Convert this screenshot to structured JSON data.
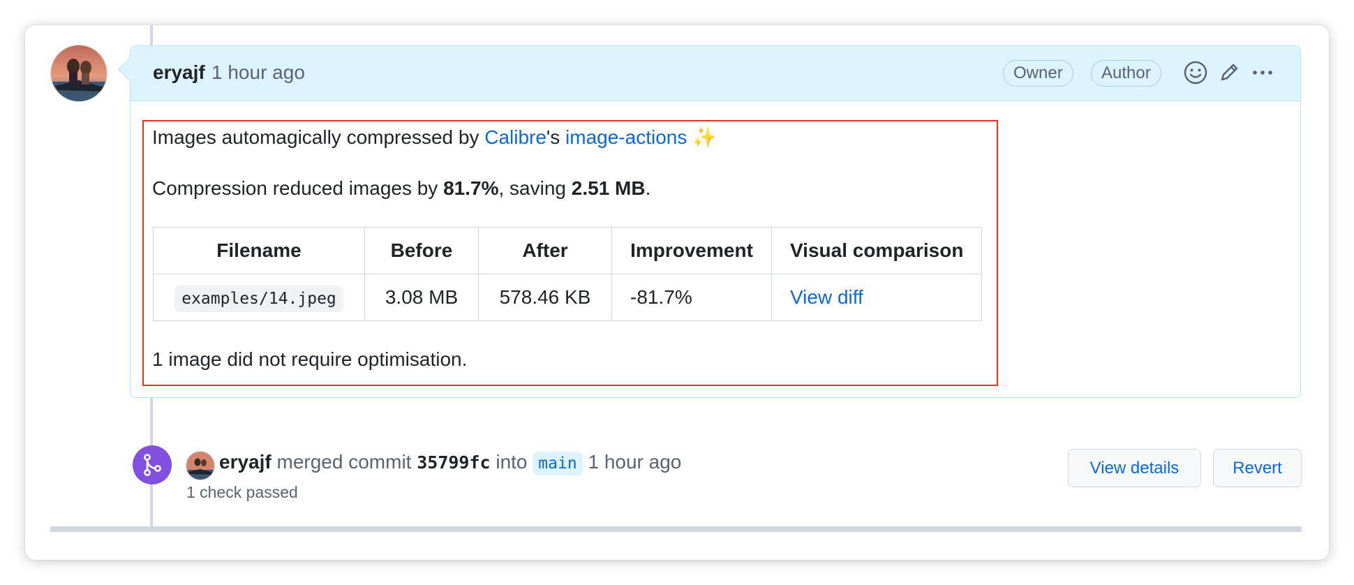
{
  "comment": {
    "author": "eryajf",
    "time": "1 hour ago",
    "badges": {
      "owner": "Owner",
      "author": "Author"
    },
    "icons": {
      "emoji": "smiley-icon",
      "edit": "pencil-icon",
      "more": "kebab-horizontal-icon"
    },
    "body": {
      "intro_prefix": "Images automagically compressed by ",
      "calibre_link": "Calibre",
      "apostrophe": "'s ",
      "image_actions_link": "image-actions",
      "sparkles": "✨",
      "summary_prefix": "Compression reduced images by ",
      "summary_percent": "81.7%",
      "summary_mid": ", saving ",
      "summary_size": "2.51 MB",
      "summary_suffix": ".",
      "table": {
        "headers": [
          "Filename",
          "Before",
          "After",
          "Improvement",
          "Visual comparison"
        ],
        "rows": [
          {
            "filename": "examples/14.jpeg",
            "before": "3.08 MB",
            "after": "578.46 KB",
            "improvement": "-81.7%",
            "link": "View diff"
          }
        ]
      },
      "footer": "1 image did not require optimisation."
    }
  },
  "merge_event": {
    "icon": "git-merge-icon",
    "user": "eryajf",
    "action": "merged commit",
    "sha": "35799fc",
    "into": "into",
    "branch": "main",
    "time": "1 hour ago",
    "checks": "1 check passed",
    "view_details_label": "View details",
    "revert_label": "Revert"
  },
  "colors": {
    "accent": "#0969da",
    "header_bg": "#ddf4ff",
    "merge_purple": "#8250df",
    "highlight_border": "#e0322a"
  }
}
